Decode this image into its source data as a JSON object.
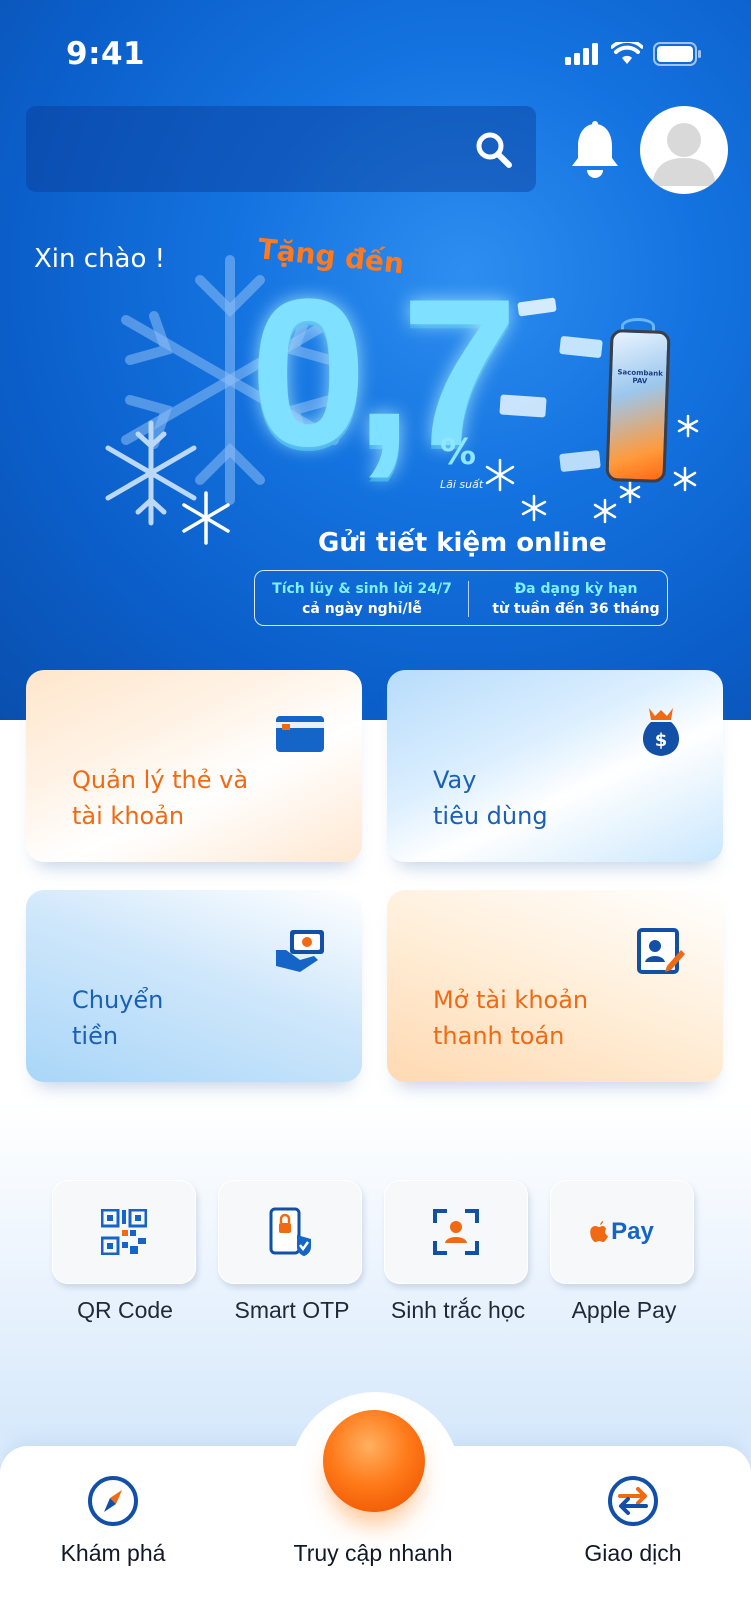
{
  "status_bar": {
    "time": "9:41"
  },
  "header": {
    "search_placeholder": ""
  },
  "greeting": "Xin chào !",
  "promo": {
    "headline": "Tặng đến",
    "rate": "0,7",
    "rate_unit": "%",
    "rate_caption": "Lãi suất",
    "title": "Gửi tiết kiệm online",
    "phone_brand": "Sacombank PAV",
    "benefits": [
      {
        "line1": "Tích lũy & sinh lời 24/7",
        "line2": "cả ngày nghỉ/lễ"
      },
      {
        "line1": "Đa dạng kỳ hạn",
        "line2": "từ tuần đến 36 tháng"
      }
    ]
  },
  "services": [
    {
      "line1": "Quản lý thẻ và",
      "line2": "tài khoản",
      "icon": "card-icon"
    },
    {
      "line1": "Vay",
      "line2": "tiêu dùng",
      "icon": "money-bag-icon"
    },
    {
      "line1": "Chuyển",
      "line2": "tiền",
      "icon": "money-transfer-icon"
    },
    {
      "line1": "Mở tài khoản",
      "line2": "thanh toán",
      "icon": "open-account-icon"
    }
  ],
  "quick_actions": [
    {
      "label": "QR Code",
      "icon": "qr-code-icon"
    },
    {
      "label": "Smart OTP",
      "icon": "smart-otp-icon"
    },
    {
      "label": "Sinh trắc học",
      "icon": "biometric-icon"
    },
    {
      "label": "Apple Pay",
      "icon": "apple-pay-icon",
      "badge_text": "Pay"
    }
  ],
  "bottom_nav": [
    {
      "label": "Khám phá",
      "icon": "compass-icon"
    },
    {
      "label": "Truy cập nhanh",
      "icon": "quick-access-orb"
    },
    {
      "label": "Giao dịch",
      "icon": "transactions-icon"
    }
  ],
  "colors": {
    "brand_blue": "#0b5ec9",
    "accent_orange": "#f06a14",
    "text_blue": "#1a5fb8",
    "promo_cyan": "#7fe0ff"
  }
}
